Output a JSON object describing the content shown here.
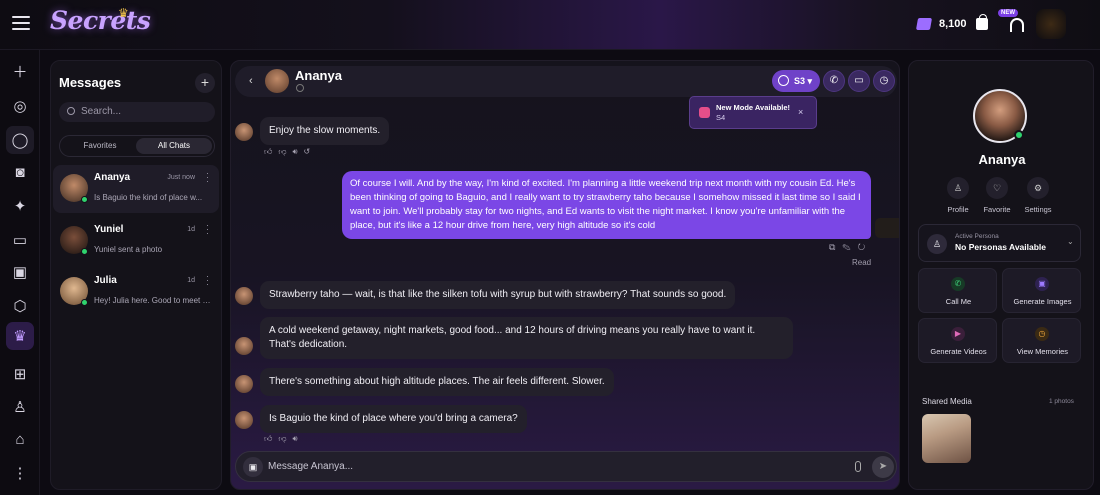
{
  "topbar": {
    "brand": "Secrets",
    "credits": "8,100",
    "new_badge": "NEW"
  },
  "colors": {
    "accent": "#7b47e6",
    "online": "#2fd36e",
    "background": "#0d0b12"
  },
  "rail": {
    "icons": [
      "plus-icon",
      "compass-icon",
      "chat-icon",
      "camera-icon",
      "sparkle-icon",
      "cards-icon",
      "images-icon",
      "box-icon",
      "crown-icon",
      "gift-icon",
      "user-icon",
      "gamepad-icon",
      "more-icon"
    ]
  },
  "messages_panel": {
    "title": "Messages",
    "search_placeholder": "Search...",
    "tabs": [
      "Favorites",
      "All Chats"
    ],
    "chats": [
      {
        "name": "Ananya",
        "time": "Just now",
        "preview": "Is Baguio the kind of place w..."
      },
      {
        "name": "Yuniel",
        "time": "1d",
        "preview": "Yuniel sent a photo"
      },
      {
        "name": "Julia",
        "time": "1d",
        "preview": "Hey! Julia here. Good to meet you"
      }
    ]
  },
  "chat": {
    "contact_name": "Ananya",
    "s3_label": "S3",
    "toast": {
      "title": "New Mode Available!",
      "subtitle": "S4",
      "close": "×"
    },
    "messages": [
      {
        "from": "ai",
        "text": "Enjoy the slow moments."
      },
      {
        "from": "user",
        "text": "Of course I will. And by the way, I'm kind of excited. I'm planning a little weekend trip next month with my cousin Ed. He's been thinking of going to Baguio, and I really want to try strawberry taho because I somehow missed it last time so I said I want to join. We'll probably stay for two nights, and Ed wants to visit the night market. I know you're unfamiliar with the place, but it's like a 12 hour drive from here, very high altitude so it's cold"
      },
      {
        "from": "ai",
        "text": "Strawberry taho — wait, is that like the silken tofu with syrup but with strawberry? That sounds so good."
      },
      {
        "from": "ai",
        "text": "A cold weekend getaway, night markets, good food... and 12 hours of driving means you really have to want it. That's dedication."
      },
      {
        "from": "ai",
        "text": "There's something about high altitude places. The air feels different. Slower."
      },
      {
        "from": "ai",
        "text": "Is Baguio the kind of place where you'd bring a camera?"
      }
    ],
    "read_status": "Read",
    "composer_placeholder": "Message Ananya..."
  },
  "profile": {
    "name": "Ananya",
    "actions": [
      "Profile",
      "Favorite",
      "Settings"
    ],
    "persona_label": "Active Persona",
    "persona_value": "No Personas Available",
    "cards": [
      "Call Me",
      "Generate Images",
      "Generate Videos",
      "View Memories"
    ],
    "shared_media_label": "Shared Media",
    "shared_media_count": "1 photos"
  }
}
